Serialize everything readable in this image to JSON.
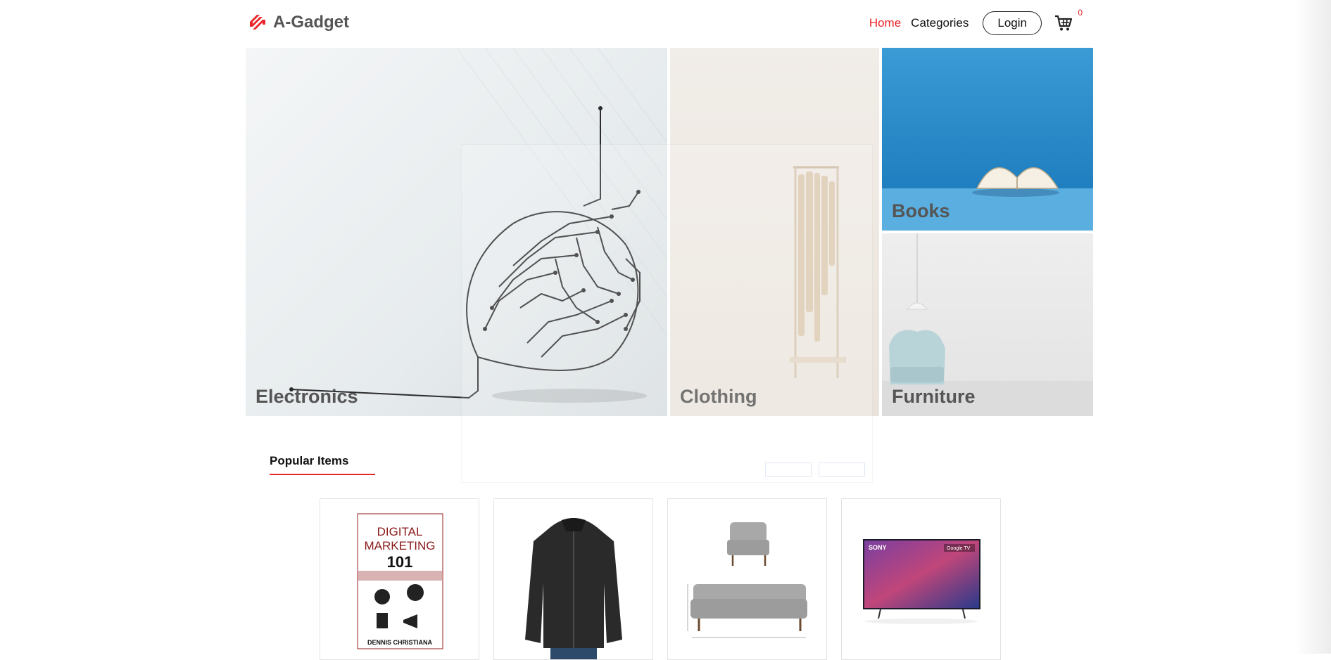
{
  "brand": {
    "name": "A-Gadget",
    "accent_color": "#e8262b"
  },
  "nav": {
    "home": "Home",
    "categories": "Categories",
    "login": "Login",
    "cart_count": "0"
  },
  "categories": [
    {
      "label": "Electronics"
    },
    {
      "label": "Clothing"
    },
    {
      "label": "Books"
    },
    {
      "label": "Furniture"
    }
  ],
  "popular": {
    "title": "Popular Items"
  },
  "products": [
    {
      "image": "book-cover-image",
      "cover_title": "DIGITAL MARKETING",
      "cover_number": "101",
      "cover_author": "DENNIS CHRISTIANA"
    },
    {
      "image": "leather-jacket-image"
    },
    {
      "image": "sofa-set-image"
    },
    {
      "image": "sony-tv-image",
      "brand_text": "SONY",
      "badge_text": "Google TV"
    }
  ],
  "icons": {
    "logo": "logo-icon",
    "cart": "cart-icon"
  }
}
